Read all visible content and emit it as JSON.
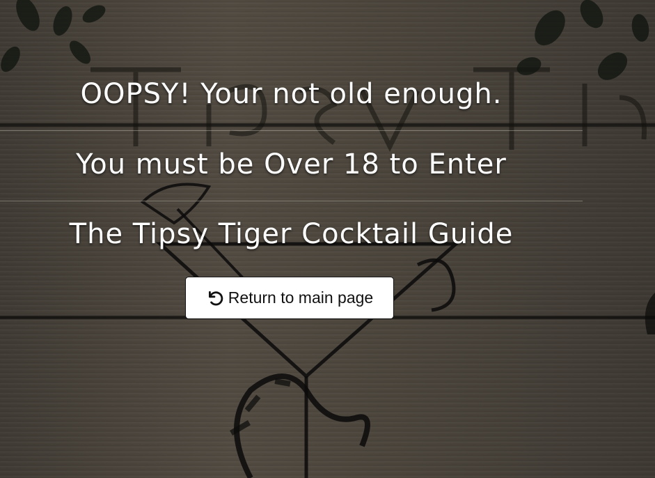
{
  "messages": {
    "line1": "OOPSY! Your not old enough.",
    "line2": "You must be Over 18 to Enter",
    "line3": "The Tipsy Tiger Cocktail Guide"
  },
  "return_button": {
    "label": "Return to main page",
    "icon": "undo-arrow-icon"
  },
  "colors": {
    "text": "#ffffff",
    "button_bg": "#ffffff",
    "button_text": "#111111",
    "wood_dark": "#3f3a33"
  }
}
